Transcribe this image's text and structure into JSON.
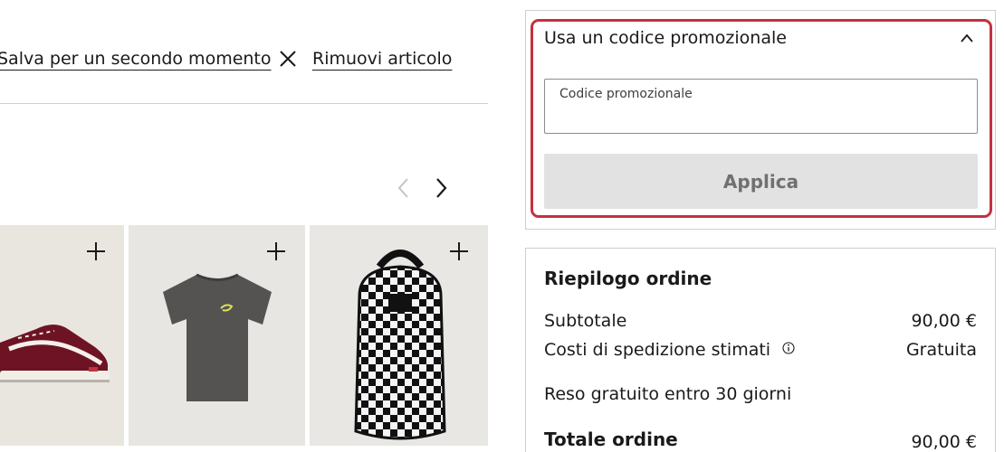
{
  "cart_item": {
    "save_later_label": "Salva per un secondo momento",
    "remove_label": "Rimuovi articolo"
  },
  "carousel": {
    "products": [
      {
        "name": "shoe",
        "icon": "plus-icon"
      },
      {
        "name": "t-shirt",
        "icon": "plus-icon"
      },
      {
        "name": "backpack",
        "icon": "plus-icon"
      }
    ]
  },
  "promo": {
    "title": "Usa un codice promozionale",
    "field_label": "Codice promozionale",
    "field_value": "",
    "apply_label": "Applica",
    "focus_color": "#c2323f"
  },
  "summary": {
    "title": "Riepilogo ordine",
    "subtotal_label": "Subtotale",
    "subtotal_value": "90,00 €",
    "shipping_label": "Costi di spedizione stimati",
    "shipping_value": "Gratuita",
    "returns_label": "Reso gratuito entro 30 giorni",
    "total_label": "Totale ordine",
    "total_value": "90,00 €"
  }
}
